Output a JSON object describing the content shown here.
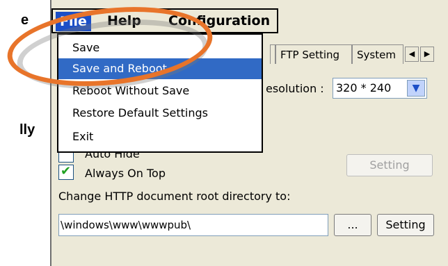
{
  "left_fragments": {
    "top": "e",
    "middle": "lly"
  },
  "menubar": {
    "file": "File",
    "help": "Help",
    "configuration": "Configuration"
  },
  "file_menu": {
    "items": [
      "Save",
      "Save and Reboot",
      "Reboot Without Save",
      "Restore Default Settings",
      "Exit"
    ],
    "highlighted": "Save and Reboot"
  },
  "tabs": {
    "partial": "h",
    "ftp": "FTP Setting",
    "system": "System"
  },
  "scroll": {
    "left": "◀",
    "right": "▶"
  },
  "resolution": {
    "label": "esolution :",
    "value": "320 * 240",
    "dropdown_icon": "chevron-down-icon"
  },
  "options": {
    "auto_hide": "Auto Hide",
    "always_on_top": "Always On Top",
    "always_on_top_checked": true
  },
  "setting_disabled": "Setting",
  "http": {
    "label": "Change HTTP document root directory to:",
    "value": "\\windows\\www\\wwwpub\\",
    "browse": "...",
    "setting": "Setting"
  },
  "colors": {
    "highlight": "#316ac5",
    "annotation_ring": "#e8742a",
    "panel": "#ece9d8"
  }
}
